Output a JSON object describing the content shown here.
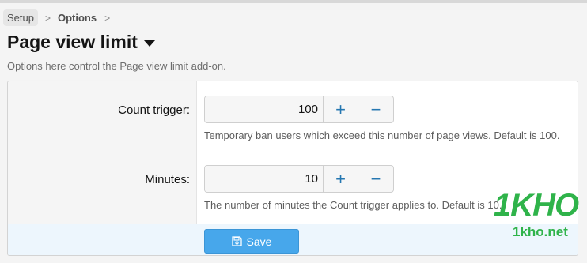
{
  "breadcrumb": {
    "items": [
      "Setup",
      "Options"
    ],
    "separator": ">"
  },
  "header": {
    "title": "Page view limit",
    "description": "Options here control the Page view limit add-on."
  },
  "form": {
    "fields": [
      {
        "label": "Count trigger:",
        "value": "100",
        "hint": "Temporary ban users which exceed this number of page views. Default is 100.",
        "increment_symbol": "+",
        "decrement_symbol": "−"
      },
      {
        "label": "Minutes:",
        "value": "10",
        "hint": "The number of minutes the Count trigger applies to. Default is 10.",
        "increment_symbol": "+",
        "decrement_symbol": "−"
      }
    ],
    "save_label": "Save",
    "save_icon": "floppy-disk-icon"
  },
  "watermark": {
    "brand": "1KHO",
    "url": "1kho.net"
  },
  "colors": {
    "accent": "#47a7eb",
    "stepper_symbol": "#2577b1",
    "watermark": "#2fb34a"
  }
}
